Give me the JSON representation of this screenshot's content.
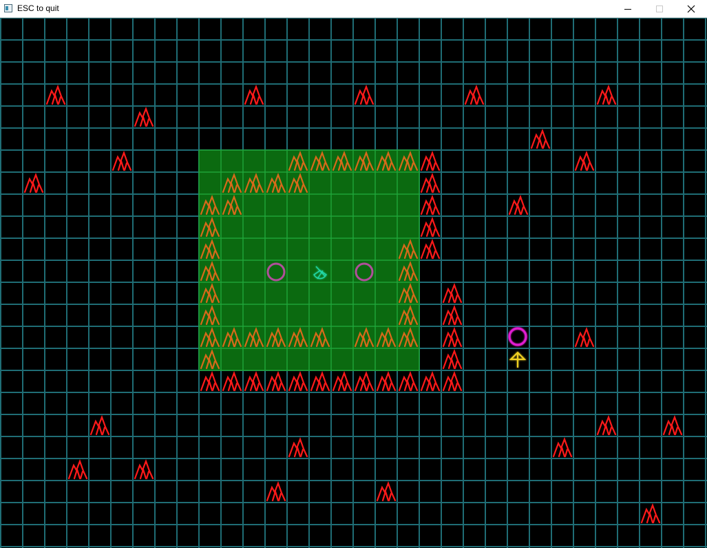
{
  "window": {
    "title": "ESC to quit",
    "icon": "app-window-icon",
    "controls": [
      "minimize-icon",
      "maximize-icon",
      "close-icon"
    ]
  },
  "colors": {
    "background": "#000000",
    "grid": "#1f6d75",
    "grid_glow": "#2fb3c0",
    "field_fill": "#0b6a10",
    "field_grid": "#1fa73a",
    "field_border": "#26c13f",
    "mountain_red": "#ff1a1a",
    "mountain_orange": "#d86a1a",
    "ring_field": "#b04f9a",
    "ring_player": "#e01fd0",
    "arrow": "#f0d020",
    "radar": "#22d9a8"
  },
  "board": {
    "grid_step": 32,
    "red_mountains": [
      [
        2,
        3
      ],
      [
        11,
        3
      ],
      [
        16,
        3
      ],
      [
        21,
        3
      ],
      [
        27,
        3
      ],
      [
        6,
        4
      ],
      [
        24,
        5
      ],
      [
        5,
        6
      ],
      [
        19,
        6
      ],
      [
        26,
        6
      ],
      [
        1,
        7
      ],
      [
        19,
        7
      ],
      [
        19,
        8
      ],
      [
        23,
        8
      ],
      [
        19,
        9
      ],
      [
        19,
        10
      ],
      [
        20,
        12
      ],
      [
        20,
        13
      ],
      [
        20,
        14
      ],
      [
        26,
        14
      ],
      [
        20,
        15
      ],
      [
        9,
        16
      ],
      [
        10,
        16
      ],
      [
        11,
        16
      ],
      [
        12,
        16
      ],
      [
        13,
        16
      ],
      [
        14,
        16
      ],
      [
        15,
        16
      ],
      [
        16,
        16
      ],
      [
        17,
        16
      ],
      [
        18,
        16
      ],
      [
        19,
        16
      ],
      [
        20,
        16
      ],
      [
        4,
        18
      ],
      [
        27,
        18
      ],
      [
        30,
        18
      ],
      [
        13,
        19
      ],
      [
        25,
        19
      ],
      [
        3,
        20
      ],
      [
        6,
        20
      ],
      [
        12,
        21
      ],
      [
        17,
        21
      ],
      [
        29,
        22
      ]
    ],
    "field": {
      "cols": [
        9,
        18
      ],
      "rows": [
        6,
        15
      ],
      "mountains": [
        [
          13,
          6
        ],
        [
          14,
          6
        ],
        [
          15,
          6
        ],
        [
          16,
          6
        ],
        [
          17,
          6
        ],
        [
          18,
          6
        ],
        [
          10,
          7
        ],
        [
          11,
          7
        ],
        [
          12,
          7
        ],
        [
          13,
          7
        ],
        [
          9,
          8
        ],
        [
          10,
          8
        ],
        [
          9,
          9
        ],
        [
          9,
          10
        ],
        [
          18,
          10
        ],
        [
          9,
          11
        ],
        [
          18,
          11
        ],
        [
          9,
          12
        ],
        [
          18,
          12
        ],
        [
          9,
          13
        ],
        [
          18,
          13
        ],
        [
          9,
          14
        ],
        [
          10,
          14
        ],
        [
          11,
          14
        ],
        [
          12,
          14
        ],
        [
          13,
          14
        ],
        [
          14,
          14
        ],
        [
          16,
          14
        ],
        [
          17,
          14
        ],
        [
          18,
          14
        ],
        [
          9,
          15
        ]
      ],
      "rings": [
        [
          12,
          11
        ],
        [
          16,
          11
        ]
      ],
      "radar": [
        14,
        11
      ]
    },
    "player_ring": [
      23,
      14
    ],
    "player_arrow": [
      23,
      15
    ]
  }
}
